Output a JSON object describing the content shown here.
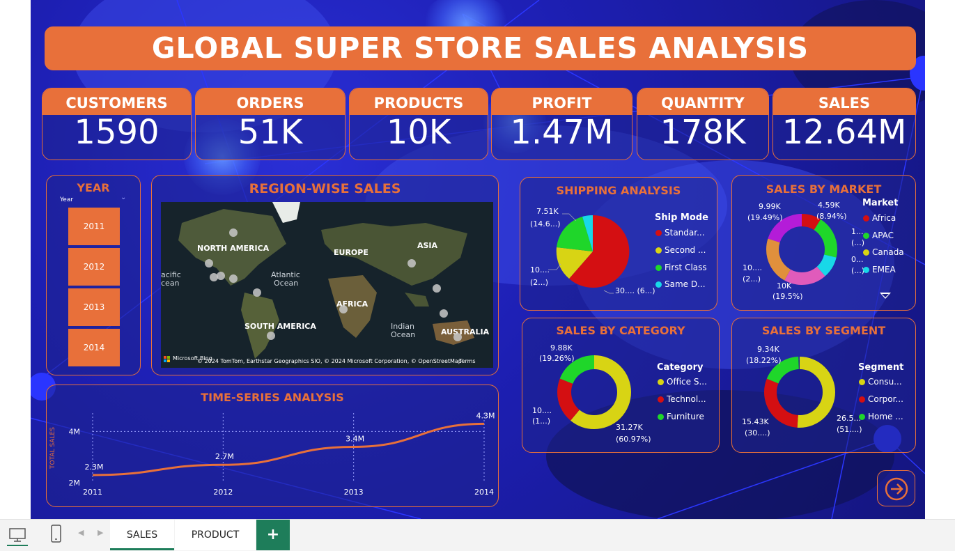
{
  "header": {
    "title": "GLOBAL SUPER STORE SALES ANALYSIS"
  },
  "kpis": [
    {
      "label": "CUSTOMERS",
      "value": "1590"
    },
    {
      "label": "ORDERS",
      "value": "51K"
    },
    {
      "label": "PRODUCTS",
      "value": "10K"
    },
    {
      "label": "PROFIT",
      "value": "1.47M"
    },
    {
      "label": "QUANTITY",
      "value": "178K"
    },
    {
      "label": "SALES",
      "value": "12.64M"
    }
  ],
  "year_slicer": {
    "title": "YEAR",
    "field": "Year",
    "years": [
      "2011",
      "2012",
      "2013",
      "2014"
    ]
  },
  "map": {
    "title": "REGION-WISE SALES",
    "labels": {
      "north_america": "NORTH AMERICA",
      "europe": "EUROPE",
      "asia": "ASIA",
      "africa": "AFRICA",
      "south_america": "SOUTH AMERICA",
      "australia": "AUSTRALIA",
      "atlantic_1": "Atlantic",
      "atlantic_2": "Ocean",
      "pacific_1": "acific",
      "pacific_2": "cean",
      "indian_1": "Indian",
      "indian_2": "Ocean"
    },
    "brand": "Microsoft Bing",
    "attribution": "© 2024 TomTom, Earthstar Geographics SIO, © 2024 Microsoft Corporation, © OpenStreetMap",
    "terms": "Terms"
  },
  "shipping": {
    "title": "SHIPPING ANALYSIS",
    "legend_title": "Ship Mode",
    "legend": [
      "Standar...",
      "Second ...",
      "First Class",
      "Same D..."
    ],
    "colors": [
      "#d40f12",
      "#d8d414",
      "#1fd62a",
      "#18d8e8"
    ],
    "labels": {
      "top_1": "7.51K",
      "top_2": "(14.6...)",
      "left_1": "10....",
      "left_2": "(2...)",
      "bottom": "30.... (6...)"
    }
  },
  "market": {
    "title": "SALES BY MARKET",
    "legend_title": "Market",
    "legend": [
      "Africa",
      "APAC",
      "Canada",
      "EMEA"
    ],
    "colors": [
      "#d40f12",
      "#1fd62a",
      "#d8d414",
      "#18d8e8"
    ],
    "labels": {
      "tl_1": "9.99K",
      "tl_2": "(19.49%)",
      "tr_1": "4.59K",
      "tr_2": "(8.94%)",
      "r1_1": "1...",
      "r1_2": "(...)",
      "r2_1": "0...",
      "r2_2": "(...)",
      "l_1": "10....",
      "l_2": "(2...)",
      "b_1": "10K",
      "b_2": "(19.5%)"
    }
  },
  "category": {
    "title": "SALES BY CATEGORY",
    "legend_title": "Category",
    "legend": [
      "Office S...",
      "Technol...",
      "Furniture"
    ],
    "colors": [
      "#d8d414",
      "#d40f12",
      "#1fd62a"
    ],
    "labels": {
      "tl_1": "9.88K",
      "tl_2": "(19.26%)",
      "l_1": "10....",
      "l_2": "(1...)",
      "br_1": "31.27K",
      "br_2": "(60.97%)"
    }
  },
  "segment": {
    "title": "SALES BY SEGMENT",
    "legend_title": "Segment",
    "legend": [
      "Consu...",
      "Corpor...",
      "Home ..."
    ],
    "colors": [
      "#d8d414",
      "#d40f12",
      "#1fd62a"
    ],
    "labels": {
      "tl_1": "9.34K",
      "tl_2": "(18.22%)",
      "l_1": "15.43K",
      "l_2": "(30....)",
      "r_1": "26.5...",
      "r_2": "(51....)"
    }
  },
  "timeseries": {
    "title": "TIME-SERIES ANALYSIS",
    "ylabel": "TOTAL SALES",
    "y_ticks": [
      "4M",
      "2M"
    ],
    "line_color": "#e8703a"
  },
  "chart_data": {
    "type": "line",
    "title": "TIME-SERIES ANALYSIS",
    "xlabel": "",
    "ylabel": "TOTAL SALES",
    "x": [
      "2011",
      "2012",
      "2013",
      "2014"
    ],
    "values": [
      2.3,
      2.7,
      3.4,
      4.3
    ],
    "value_labels": [
      "2.3M",
      "2.7M",
      "3.4M",
      "4.3M"
    ],
    "ylim": [
      2,
      4.5
    ],
    "grid": true
  },
  "bottom": {
    "tabs": [
      "SALES",
      "PRODUCT"
    ],
    "add": "+"
  }
}
